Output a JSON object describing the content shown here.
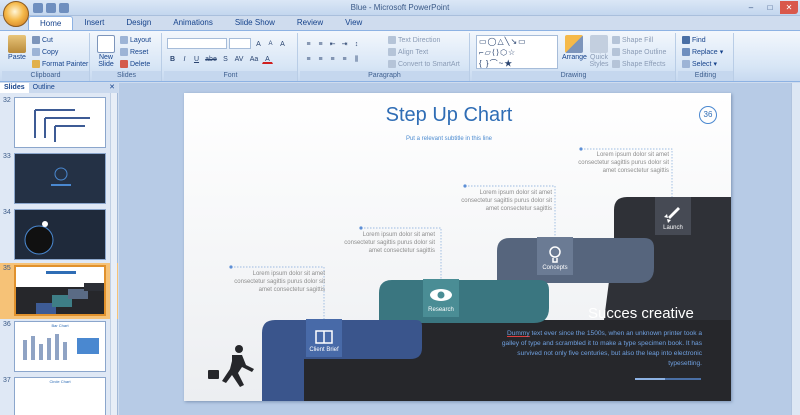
{
  "window": {
    "title": "Blue - Microsoft PowerPoint"
  },
  "tabs": [
    "Home",
    "Insert",
    "Design",
    "Animations",
    "Slide Show",
    "Review",
    "View"
  ],
  "ribbon": {
    "clipboard": {
      "paste": "Paste",
      "cut": "Cut",
      "copy": "Copy",
      "format_painter": "Format Painter",
      "label": "Clipboard"
    },
    "slides": {
      "new_slide": "New",
      "new_slide2": "Slide",
      "layout": "Layout",
      "reset": "Reset",
      "delete": "Delete",
      "label": "Slides"
    },
    "font": {
      "label": "Font",
      "bold": "B",
      "italic": "I",
      "underline": "U",
      "strike": "abe",
      "shadow": "S",
      "spacing": "AV",
      "case": "Aa",
      "color": "A",
      "grow": "A",
      "shrink": "A",
      "clear": "A"
    },
    "paragraph": {
      "text_direction": "Text Direction",
      "align_text": "Align Text",
      "convert": "Convert to SmartArt",
      "label": "Paragraph"
    },
    "drawing": {
      "arrange": "Arrange",
      "quick_styles": "Quick",
      "quick_styles2": "Styles",
      "shape_fill": "Shape Fill",
      "shape_outline": "Shape Outline",
      "shape_effects": "Shape Effects",
      "label": "Drawing"
    },
    "editing": {
      "find": "Find",
      "replace": "Replace",
      "select": "Select",
      "label": "Editing"
    }
  },
  "panel": {
    "tabs": [
      "Slides",
      "Outline"
    ],
    "thumbs": [
      {
        "num": "32",
        "style": "light",
        "title": ""
      },
      {
        "num": "33",
        "style": "dark",
        "title": ""
      },
      {
        "num": "34",
        "style": "dark",
        "title": ""
      },
      {
        "num": "35",
        "style": "steps",
        "title": ""
      },
      {
        "num": "36",
        "style": "barchart",
        "title": "Bar Chart"
      },
      {
        "num": "37",
        "style": "light",
        "title": "Circle Chart"
      }
    ],
    "selected": "35"
  },
  "slide": {
    "title": "Step Up Chart",
    "subtitle": "Put a relevant subtitle in this line",
    "page_number": "36",
    "annotations": [
      {
        "text": "Lorem ipsum dolor sit amet consectetur sagittis purus dolor sit amet consectetur sagittis"
      },
      {
        "text": "Lorem ipsum dolor sit amet consectetur sagittis purus dolor sit amet consectetur sagittis"
      },
      {
        "text": "Lorem ipsum dolor sit amet consectetur sagittis purus dolor sit amet consectetur sagittis"
      },
      {
        "text": "Lorem ipsum dolor sit amet consectetur sagittis purus dolor sit amet consectetur sagittis"
      }
    ],
    "steps": [
      {
        "label": "Client Brief",
        "icon": "book-icon",
        "color": "#3d5b95"
      },
      {
        "label": "Research",
        "icon": "eye-icon",
        "color": "#3e7e86"
      },
      {
        "label": "Concepts",
        "icon": "lightbulb-icon",
        "color": "#5a6b85"
      },
      {
        "label": "Launch",
        "icon": "rocket-icon",
        "color": "#2c2f36"
      }
    ],
    "heading": "Succes creative",
    "paragraph_first": "Dummy",
    "paragraph_rest": " text ever since the 1500s, when an unknown printer took a galley of type and scrambled it to make a type specimen book. It has survived not only five centuries, but also the leap into electronic typesetting.",
    "colors": {
      "title": "#2f6db5",
      "dark_panel": "#26272b",
      "accent_text": "#6fa0e0"
    }
  }
}
